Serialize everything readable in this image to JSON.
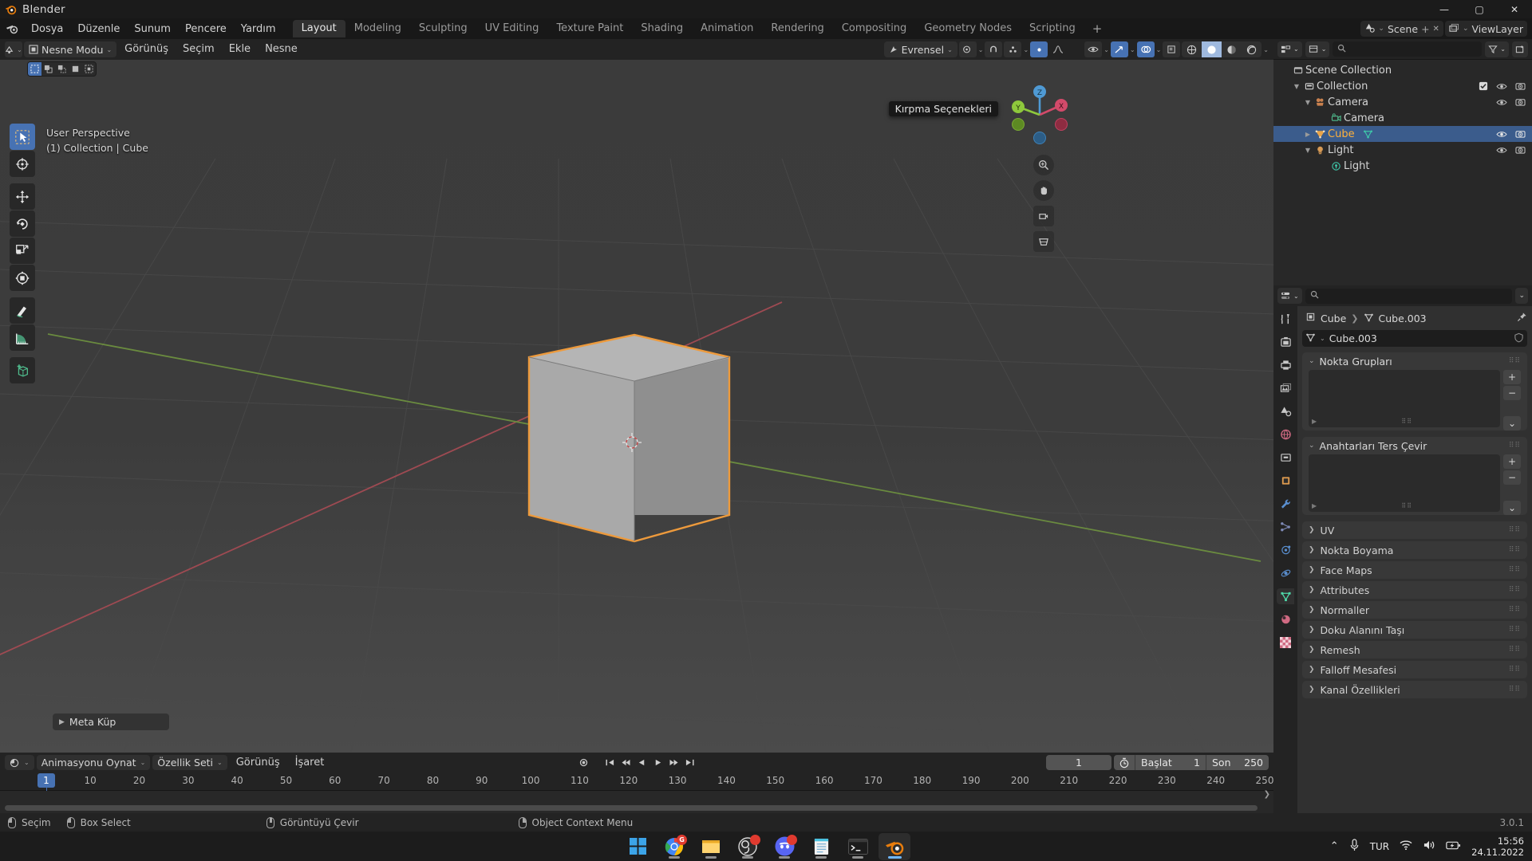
{
  "window": {
    "title": "Blender",
    "app_icon": "blender-logo-icon",
    "minimize": "—",
    "maximize": "▢",
    "close": "✕"
  },
  "topbar": {
    "menus": [
      "Dosya",
      "Düzenle",
      "Sunum",
      "Pencere",
      "Yardım"
    ],
    "workspaces": [
      {
        "label": "Layout",
        "active": true
      },
      {
        "label": "Modeling",
        "active": false
      },
      {
        "label": "Sculpting",
        "active": false
      },
      {
        "label": "UV Editing",
        "active": false
      },
      {
        "label": "Texture Paint",
        "active": false
      },
      {
        "label": "Shading",
        "active": false
      },
      {
        "label": "Animation",
        "active": false
      },
      {
        "label": "Rendering",
        "active": false
      },
      {
        "label": "Compositing",
        "active": false
      },
      {
        "label": "Geometry Nodes",
        "active": false
      },
      {
        "label": "Scripting",
        "active": false
      }
    ],
    "add_workspace": "+",
    "scene_name": "Scene",
    "view_layer_name": "ViewLayer",
    "scene_icon": "scene-icon",
    "viewlayer_icon": "viewlayer-icon",
    "new_scene": "+",
    "remove_scene": "✕"
  },
  "viewport": {
    "editor_type_icon": "editor-type-icon",
    "mode": "Nesne Modu",
    "menus": [
      "Görünüş",
      "Seçim",
      "Ekle",
      "Nesne"
    ],
    "transform_orientation": "Evrensel",
    "snap_icon": "magnet-icon",
    "proportional_icon": "proportional-edit-icon",
    "select_modes": [
      "tweak",
      "box",
      "circle",
      "lasso"
    ],
    "overlay_text_line1": "User Perspective",
    "overlay_text_line2": "(1) Collection | Cube",
    "tooltip": "Kırpma Seçenekleri",
    "operator_panel": "Meta Küp",
    "gizmo_axes": [
      "X",
      "Y",
      "Z"
    ],
    "tools": [
      {
        "name": "tweak-tool",
        "active": true
      },
      {
        "name": "cursor-tool",
        "active": false
      },
      {
        "name": "move-tool",
        "active": false
      },
      {
        "name": "rotate-tool",
        "active": false
      },
      {
        "name": "scale-tool",
        "active": false
      },
      {
        "name": "transform-tool",
        "active": false
      },
      {
        "name": "annotate-tool",
        "active": false
      },
      {
        "name": "measure-tool",
        "active": false
      },
      {
        "name": "add-cube-tool",
        "active": false
      }
    ],
    "shading_modes": [
      "wireframe",
      "solid",
      "material-preview",
      "rendered"
    ],
    "shading_active": "solid",
    "nav_buttons": [
      "zoom-icon",
      "pan-hand-icon",
      "camera-view-icon",
      "ortho-persp-icon"
    ]
  },
  "outliner": {
    "display_mode": "View Layer",
    "filter_icon": "filter-icon",
    "search_placeholder": "",
    "new_collection_icon": "new-collection-icon",
    "rows": [
      {
        "label": "Scene Collection",
        "indent": 0,
        "icon": "scene-collection-icon",
        "tri": "",
        "selected": false,
        "checkbox": false,
        "eye": false,
        "camera": false
      },
      {
        "label": "Collection",
        "indent": 1,
        "icon": "collection-icon",
        "tri": "▼",
        "selected": false,
        "checkbox": true,
        "eye": true,
        "camera": true
      },
      {
        "label": "Camera",
        "indent": 2,
        "icon": "camera-object-icon",
        "tri": "▼",
        "selected": false,
        "checkbox": false,
        "eye": true,
        "camera": true
      },
      {
        "label": "Camera",
        "indent": 3,
        "icon": "camera-data-icon",
        "tri": "",
        "selected": false,
        "checkbox": false,
        "eye": false,
        "camera": false
      },
      {
        "label": "Cube",
        "indent": 2,
        "icon": "mesh-object-icon",
        "tri": "▶",
        "selected": true,
        "checkbox": false,
        "eye": true,
        "camera": true,
        "extra_icon": "mesh-data-icon"
      },
      {
        "label": "Light",
        "indent": 2,
        "icon": "light-object-icon",
        "tri": "▼",
        "selected": false,
        "checkbox": false,
        "eye": true,
        "camera": true
      },
      {
        "label": "Light",
        "indent": 3,
        "icon": "light-data-icon",
        "tri": "",
        "selected": false,
        "checkbox": false,
        "eye": false,
        "camera": false
      }
    ]
  },
  "properties": {
    "editor_icon": "properties-editor-icon",
    "search_placeholder": "",
    "breadcrumb": [
      "Cube",
      "Cube.003"
    ],
    "breadcrumb_icons": [
      "object-icon",
      "mesh-data-icon"
    ],
    "datablock_name": "Cube.003",
    "shield_icon": "fake-user-shield-icon",
    "pin_icon": "pin-icon",
    "tabs": [
      {
        "name": "tool-tab",
        "icon": "wrench-screwdriver-icon",
        "active": false
      },
      {
        "name": "render-tab",
        "icon": "camera-back-icon",
        "active": false
      },
      {
        "name": "output-tab",
        "icon": "printer-icon",
        "active": false
      },
      {
        "name": "viewlayer-tab",
        "icon": "images-icon",
        "active": false
      },
      {
        "name": "scene-tab",
        "icon": "cone-icon",
        "active": false
      },
      {
        "name": "world-tab",
        "icon": "world-globe-icon",
        "active": false
      },
      {
        "name": "collection-tab",
        "icon": "collection-box-icon",
        "active": false
      },
      {
        "name": "object-tab",
        "icon": "orange-square-icon",
        "active": false
      },
      {
        "name": "modifier-tab",
        "icon": "blue-wrench-icon",
        "active": false
      },
      {
        "name": "particles-tab",
        "icon": "particles-icon",
        "active": false
      },
      {
        "name": "physics-tab",
        "icon": "physics-orbit-icon",
        "active": false
      },
      {
        "name": "constraints-tab",
        "icon": "constraint-icon",
        "active": false
      },
      {
        "name": "data-tab",
        "icon": "green-triangle-data-icon",
        "active": true
      },
      {
        "name": "material-tab",
        "icon": "material-sphere-icon",
        "active": false
      },
      {
        "name": "texture-tab",
        "icon": "checker-texture-icon",
        "active": false
      }
    ],
    "panels": [
      {
        "label": "Nokta Grupları",
        "open": true,
        "has_list": true
      },
      {
        "label": "Anahtarları Ters Çevir",
        "open": true,
        "has_list": true
      },
      {
        "label": "UV",
        "open": false
      },
      {
        "label": "Nokta Boyama",
        "open": false
      },
      {
        "label": "Face Maps",
        "open": false
      },
      {
        "label": "Attributes",
        "open": false
      },
      {
        "label": "Normaller",
        "open": false
      },
      {
        "label": "Doku Alanını Taşı",
        "open": false
      },
      {
        "label": "Remesh",
        "open": false
      },
      {
        "label": "Falloff Mesafesi",
        "open": false
      },
      {
        "label": "Kanal Özellikleri",
        "open": false
      }
    ],
    "list_add": "+",
    "list_remove": "−",
    "list_dropdown": "⌄"
  },
  "timeline": {
    "editor_icon": "timeline-editor-icon",
    "playback_menu": "Animasyonu Oynat",
    "keying_menu": "Özellik Seti",
    "menus": [
      "Görünüş",
      "İşaret"
    ],
    "record_icon": "record-icon",
    "transport": [
      "jump-start",
      "prev-keyframe",
      "play-reverse",
      "play",
      "next-keyframe",
      "jump-end"
    ],
    "current_frame": "1",
    "clock_icon": "use-preview-range-icon",
    "start_label": "Başlat",
    "start_value": "1",
    "end_label": "Son",
    "end_value": "250",
    "ticks": [
      1,
      10,
      20,
      30,
      40,
      50,
      60,
      70,
      80,
      90,
      100,
      110,
      120,
      130,
      140,
      150,
      160,
      170,
      180,
      190,
      200,
      210,
      220,
      230,
      240,
      250
    ],
    "playhead_frame": "1"
  },
  "statusbar": {
    "items": [
      {
        "mouse": "left",
        "label": "Seçim"
      },
      {
        "mouse": "drag",
        "label": "Box Select"
      },
      {
        "mouse": "middle",
        "label": "Görüntüyü Çevir"
      },
      {
        "mouse": "right",
        "label": "Object Context Menu"
      }
    ],
    "version": "3.0.1"
  },
  "taskbar": {
    "apps": [
      {
        "name": "start-windows-icon",
        "badge": "",
        "active": false,
        "running": false
      },
      {
        "name": "google-chrome-icon",
        "badge": "G",
        "active": false,
        "running": true
      },
      {
        "name": "file-explorer-icon",
        "badge": "",
        "active": false,
        "running": true
      },
      {
        "name": "obs-studio-icon",
        "badge": "•",
        "active": false,
        "running": true
      },
      {
        "name": "discord-icon",
        "badge": "•",
        "active": false,
        "running": true
      },
      {
        "name": "notepad-icon",
        "badge": "",
        "active": false,
        "running": true
      },
      {
        "name": "terminal-icon",
        "badge": "",
        "active": false,
        "running": true
      },
      {
        "name": "blender-taskbar-icon",
        "badge": "",
        "active": true,
        "running": true
      }
    ],
    "tray": {
      "chevron": "⌃",
      "mic_icon": "microphone-icon",
      "language": "TUR",
      "wifi_icon": "wifi-icon",
      "volume_icon": "speaker-icon",
      "battery_icon": "battery-charging-icon",
      "time": "15:56",
      "date": "24.11.2022"
    }
  }
}
